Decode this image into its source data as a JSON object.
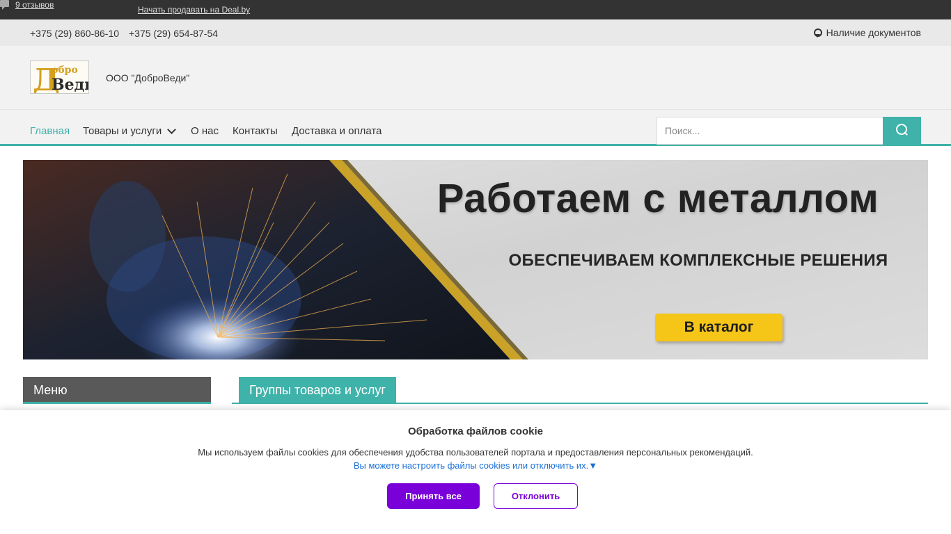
{
  "topbar": {
    "sell_link": "Начать продавать на Deal.by",
    "reviews": "9 отзывов"
  },
  "contacts": {
    "phone1": "+375 (29) 860-86-10",
    "phone2": "+375 (29) 654-87-54",
    "documents": "Наличие документов"
  },
  "header": {
    "logo_text": "Добро Веди",
    "company": "ООО \"ДоброВеди\""
  },
  "nav": {
    "home": "Главная",
    "goods": "Товары и услуги",
    "about": "О нас",
    "contacts": "Контакты",
    "delivery": "Доставка и оплата",
    "search_placeholder": "Поиск..."
  },
  "banner": {
    "title": "Работаем с металлом",
    "subtitle": "ОБЕСПЕЧИВАЕМ КОМПЛЕКСНЫЕ РЕШЕНИЯ",
    "button": "В каталог"
  },
  "sections": {
    "menu": "Меню",
    "groups": "Группы товаров и услуг"
  },
  "cookie": {
    "title": "Обработка файлов cookie",
    "text": "Мы используем файлы cookies для обеспечения удобства пользователей портала и предоставления персональных рекомендаций.",
    "link": "Вы можете настроить файлы cookies или отключить их.▼",
    "accept": "Принять все",
    "decline": "Отклонить"
  },
  "colors": {
    "accent": "#3fb2a9",
    "topbar": "#333333",
    "cookie_button": "#7a00d9",
    "banner_button": "#f5c518"
  },
  "icons": [
    "chat-icon",
    "award-icon",
    "chevron-down-icon",
    "search-icon"
  ]
}
